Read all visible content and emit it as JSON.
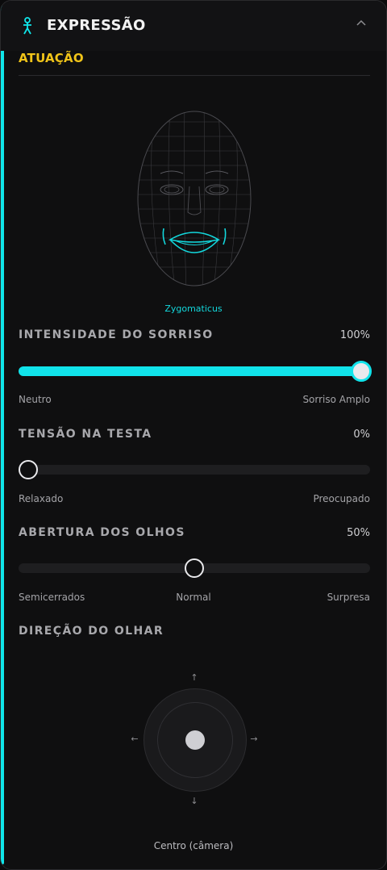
{
  "panel": {
    "title": "EXPRESSÃO",
    "collapse_icon": "chevron-up-icon",
    "person_icon": "person-icon",
    "accent_color": "#10e6ea",
    "section_label": "ATUAÇÃO",
    "section_color": "#f0c419"
  },
  "face": {
    "muscle_label": "Zygomaticus"
  },
  "smile": {
    "label": "INTENSIDADE DO SORRISO",
    "value_text": "100%",
    "value": 1.0,
    "min_label": "Neutro",
    "max_label": "Sorriso Amplo"
  },
  "forehead": {
    "label": "TENSÃO NA TESTA",
    "value_text": "0%",
    "value": 0.0,
    "min_label": "Relaxado",
    "max_label": "Preocupado"
  },
  "eyes": {
    "label": "ABERTURA DOS OLHOS",
    "value_text": "50%",
    "value": 0.5,
    "min_label": "Semicerrados",
    "mid_label": "Normal",
    "max_label": "Surpresa"
  },
  "gaze": {
    "label": "DIREÇÃO DO OLHAR",
    "up_arrow": "↑",
    "down_arrow": "↓",
    "left_arrow": "←",
    "right_arrow": "→",
    "position_label": "Centro (câmera)"
  }
}
